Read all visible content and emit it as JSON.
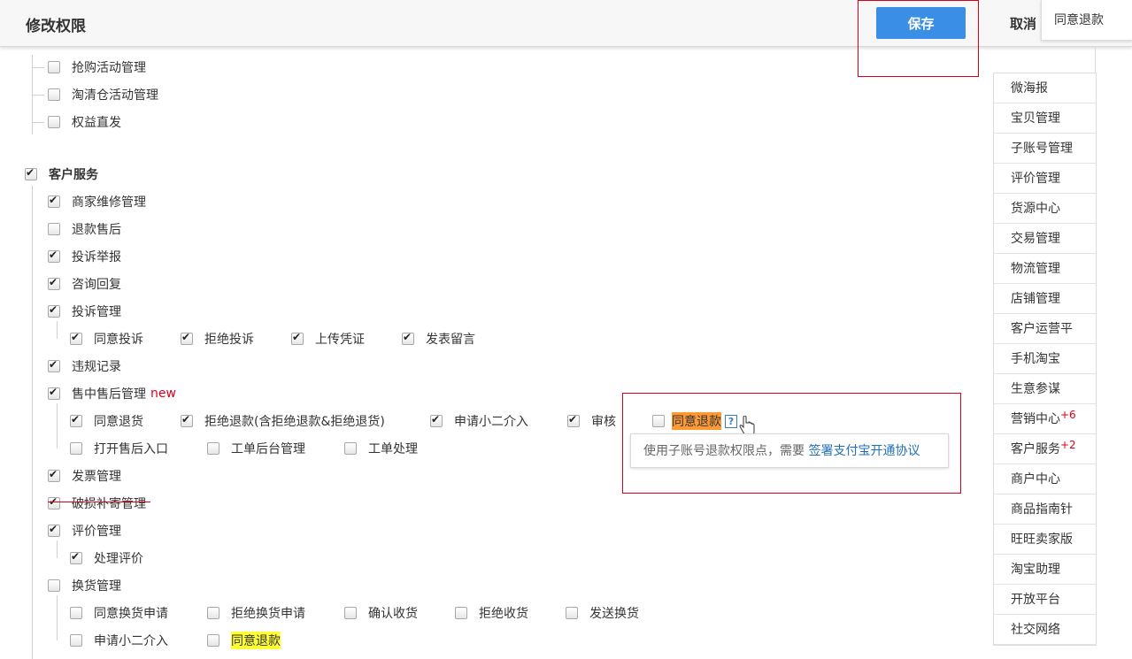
{
  "header": {
    "title": "修改权限",
    "save_label": "保存",
    "cancel_label": "取消",
    "floating_tab": "同意退款"
  },
  "tree": {
    "top_items": [
      {
        "label": "抢购活动管理",
        "checked": false
      },
      {
        "label": "淘清仓活动管理",
        "checked": false
      },
      {
        "label": "权益直发",
        "checked": false
      }
    ],
    "section": {
      "label": "客户服务",
      "checked": true
    },
    "items": [
      {
        "label": "商家维修管理",
        "checked": true
      },
      {
        "label": "退款售后",
        "checked": false
      },
      {
        "label": "投诉举报",
        "checked": true
      },
      {
        "label": "咨询回复",
        "checked": true
      },
      {
        "label": "投诉管理",
        "checked": true
      },
      {
        "label": "违规记录",
        "checked": true
      },
      {
        "label": "售中售后管理",
        "checked": true,
        "tag": "new"
      },
      {
        "label": "发票管理",
        "checked": true
      },
      {
        "label": "破损补寄管理",
        "checked": true
      },
      {
        "label": "评价管理",
        "checked": true
      },
      {
        "label": "换货管理",
        "checked": false
      }
    ],
    "complaint_children": [
      {
        "label": "同意投诉",
        "checked": true
      },
      {
        "label": "拒绝投诉",
        "checked": true
      },
      {
        "label": "上传凭证",
        "checked": true
      },
      {
        "label": "发表留言",
        "checked": true
      }
    ],
    "aftersale_row1": [
      {
        "label": "同意退货",
        "checked": true
      },
      {
        "label": "拒绝退款(含拒绝退款&拒绝退货)",
        "checked": true
      },
      {
        "label": "申请小二介入",
        "checked": true
      },
      {
        "label": "审核",
        "checked": true
      },
      {
        "label": "同意退款",
        "checked": false
      }
    ],
    "aftersale_row2": [
      {
        "label": "打开售后入口",
        "checked": false
      },
      {
        "label": "工单后台管理",
        "checked": false
      },
      {
        "label": "工单处理",
        "checked": false
      }
    ],
    "review_children": [
      {
        "label": "处理评价",
        "checked": true
      }
    ],
    "exchange_row1": [
      {
        "label": "同意换货申请",
        "checked": false
      },
      {
        "label": "拒绝换货申请",
        "checked": false
      },
      {
        "label": "确认收货",
        "checked": false
      },
      {
        "label": "拒绝收货",
        "checked": false
      },
      {
        "label": "发送换货",
        "checked": false
      }
    ],
    "exchange_row2": [
      {
        "label": "申请小二介入",
        "checked": false
      },
      {
        "label": "同意退款",
        "checked": false
      }
    ]
  },
  "tooltip": {
    "text": "使用子账号退款权限点，需要",
    "link": "签署支付宝开通协议",
    "help_glyph": "?"
  },
  "sidenav": [
    {
      "label": "微海报"
    },
    {
      "label": "宝贝管理"
    },
    {
      "label": "子账号管理"
    },
    {
      "label": "评价管理"
    },
    {
      "label": "货源中心"
    },
    {
      "label": "交易管理"
    },
    {
      "label": "物流管理"
    },
    {
      "label": "店铺管理"
    },
    {
      "label": "客户运营平"
    },
    {
      "label": "手机淘宝"
    },
    {
      "label": "生意参谋"
    },
    {
      "label": "营销中心",
      "badge": "+6"
    },
    {
      "label": "客户服务",
      "badge": "+2"
    },
    {
      "label": "商户中心"
    },
    {
      "label": "商品指南针"
    },
    {
      "label": "旺旺卖家版"
    },
    {
      "label": "淘宝助理"
    },
    {
      "label": "开放平台"
    },
    {
      "label": "社交网络"
    }
  ],
  "colors": {
    "primary": "#3a8ee6",
    "annotation_red": "#d9001b",
    "highlight_yellow": "#ffff33",
    "highlight_orange": "#ff9933",
    "link": "#1f6fb5"
  }
}
